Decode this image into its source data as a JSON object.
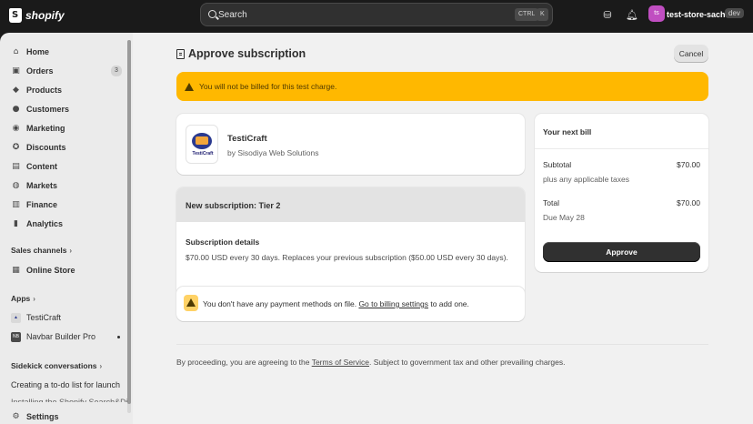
{
  "topbar": {
    "brand": "shopify",
    "search_placeholder": "Search",
    "kbd_ctrl": "CTRL",
    "kbd_k": "K",
    "avatar_initials": "ts",
    "store_name": "test-store-sachin",
    "store_badge": "dev",
    "icons": [
      "shopify-bag-icon",
      "search-icon",
      "database-icon",
      "bell-icon"
    ]
  },
  "sidebar": {
    "items": [
      {
        "label": "Home",
        "icon": "home-icon"
      },
      {
        "label": "Orders",
        "icon": "orders-icon",
        "count": "3"
      },
      {
        "label": "Products",
        "icon": "tag-icon"
      },
      {
        "label": "Customers",
        "icon": "person-icon"
      },
      {
        "label": "Marketing",
        "icon": "target-icon"
      },
      {
        "label": "Discounts",
        "icon": "discount-icon"
      },
      {
        "label": "Content",
        "icon": "content-icon"
      },
      {
        "label": "Markets",
        "icon": "globe-icon"
      },
      {
        "label": "Finance",
        "icon": "bank-icon"
      },
      {
        "label": "Analytics",
        "icon": "chart-icon"
      }
    ],
    "sales_channels_label": "Sales channels",
    "online_store": "Online Store",
    "apps_label": "Apps",
    "apps": [
      "TestiCraft",
      "Navbar Builder Pro"
    ],
    "sidekick_label": "Sidekick conversations",
    "conversation": "Creating a to-do list for launch",
    "conversation_partial": "Installing the Shopify Search&Di",
    "settings": "Settings"
  },
  "main": {
    "title": "Approve subscription",
    "cancel": "Cancel",
    "banner": "You will not be billed for this test charge.",
    "app": {
      "name": "TestiCraft",
      "developer": "by Sisodiya Web Solutions",
      "logo_text": "TestiCraft"
    },
    "subscription": {
      "header": "New subscription: Tier 2",
      "details_label": "Subscription details",
      "details": "$70.00 USD every 30 days. Replaces your previous subscription ($50.00 USD every 30 days)."
    },
    "payment": {
      "text_before": "You don't have any payment methods on file. ",
      "link": "Go to billing settings",
      "text_after": " to add one."
    },
    "bill": {
      "title": "Your next bill",
      "subtotal_label": "Subtotal",
      "subtotal_value": "$70.00",
      "taxes_note": "plus any applicable taxes",
      "total_label": "Total",
      "total_value": "$70.00",
      "due": "Due May 28",
      "approve": "Approve"
    },
    "legal": {
      "before": "By proceeding, you are agreeing to the ",
      "link": "Terms of Service",
      "after": ". Subject to government tax and other prevailing charges."
    }
  },
  "colors": {
    "banner": "#ffb800",
    "approve_button": "#303030",
    "avatar": "#c04ec1"
  }
}
